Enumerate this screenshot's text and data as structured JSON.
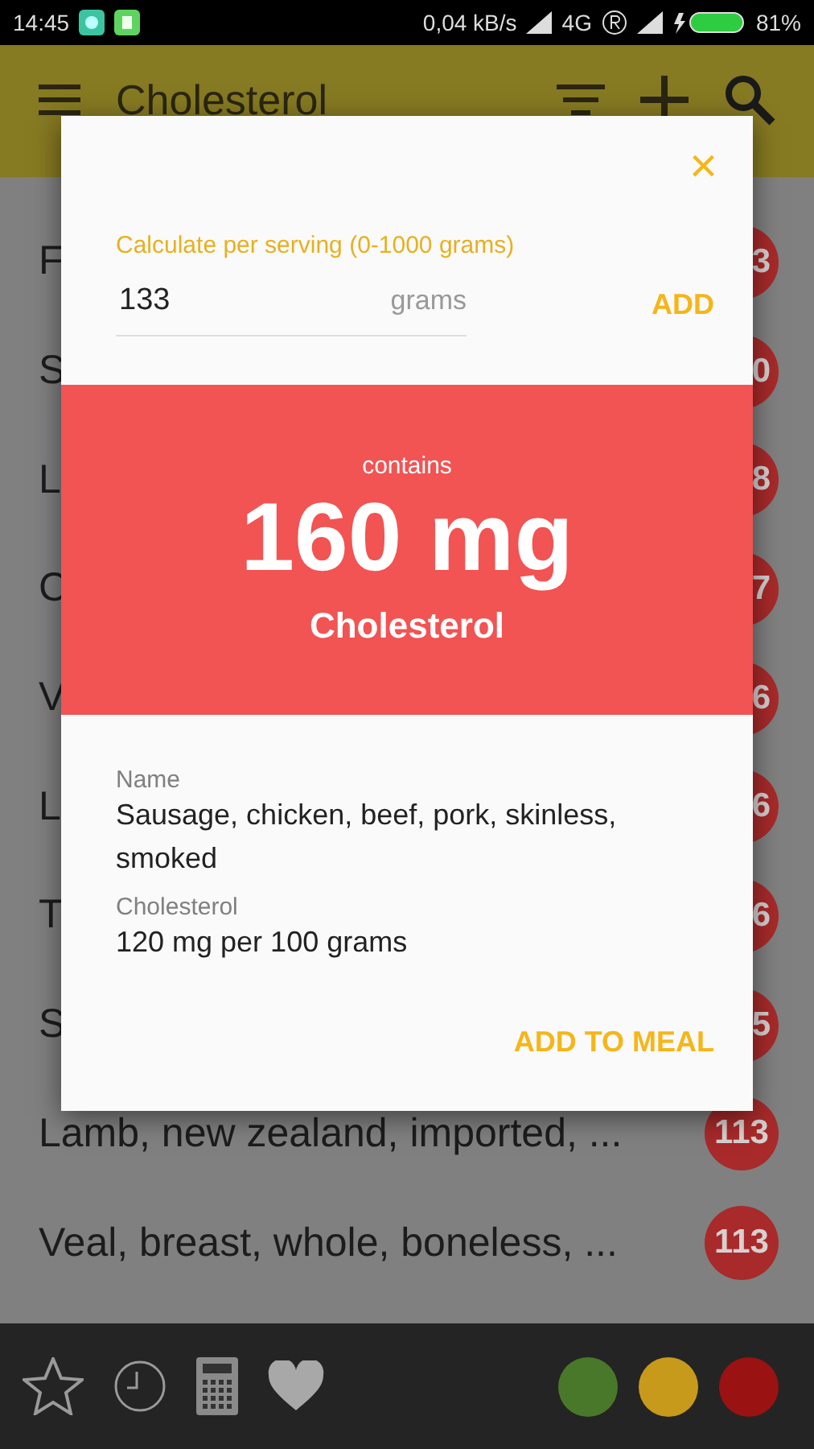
{
  "status_bar": {
    "time": "14:45",
    "speed": "0,04 kB/s",
    "network": "4G",
    "battery": "81%"
  },
  "toolbar": {
    "title": "Cholesterol"
  },
  "list": [
    {
      "name": "F",
      "value": "3"
    },
    {
      "name": "S",
      "value": "0"
    },
    {
      "name": "L",
      "value": "8"
    },
    {
      "name": "C",
      "value": "7"
    },
    {
      "name": "V",
      "value": "6"
    },
    {
      "name": "L",
      "value": "6"
    },
    {
      "name": "T",
      "value": "6"
    },
    {
      "name": "S",
      "value": "5"
    },
    {
      "name": "Lamb, new zealand, imported, ...",
      "value": "113"
    },
    {
      "name": "Veal, breast, whole, boneless, ...",
      "value": "113"
    }
  ],
  "dialog": {
    "close": "×",
    "serving_label": "Calculate per serving (0-1000 grams)",
    "serving_value": "133",
    "unit": "grams",
    "add_button": "ADD",
    "contains": "contains",
    "amount": "160 mg",
    "nutrient": "Cholesterol",
    "name_label": "Name",
    "name_value": "Sausage, chicken, beef, pork, skinless, smoked",
    "nutrient_label": "Cholesterol",
    "nutrient_value": "120 mg per 100 grams",
    "meal_button": "ADD TO MEAL"
  },
  "filters": [
    {
      "color": "#4a782a"
    },
    {
      "color": "#c89a1c"
    },
    {
      "color": "#9a1212"
    }
  ]
}
